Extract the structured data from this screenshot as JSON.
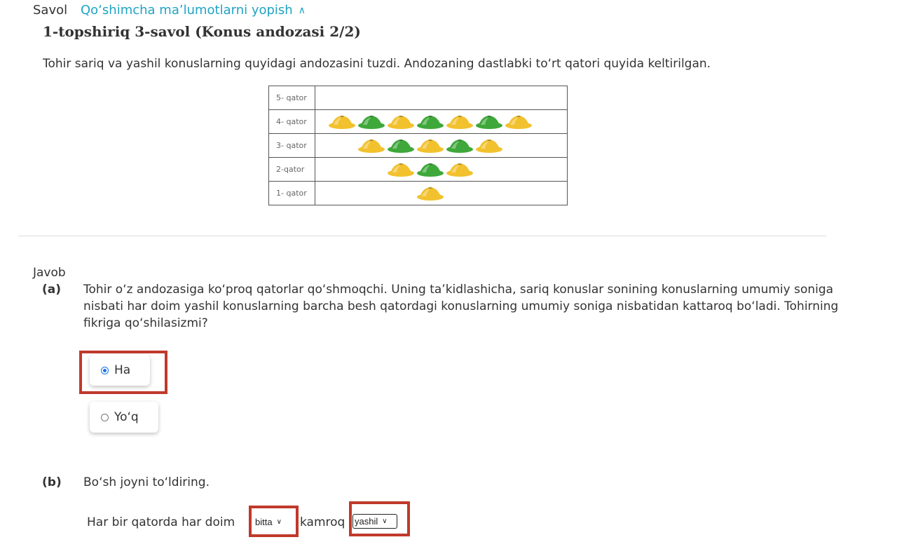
{
  "header": {
    "savol_label": "Savol",
    "toggle_link": "Qo‘shimcha ma’lumotlarni yopish",
    "toggle_icon": "chevron-up-icon"
  },
  "question": {
    "title": "1-topshiriq 3-savol (Konus andozasi 2/2)",
    "intro": "Tohir sariq va yashil konuslarning quyidagi andozasini tuzdi. Andozaning dastlabki to‘rt qatori quyida keltirilgan."
  },
  "pattern_table": {
    "rows": [
      {
        "label": "5- qator",
        "cones": []
      },
      {
        "label": "4- qator",
        "cones": [
          "yellow",
          "green",
          "yellow",
          "green",
          "yellow",
          "green",
          "yellow"
        ]
      },
      {
        "label": "3- qator",
        "cones": [
          "yellow",
          "green",
          "yellow",
          "green",
          "yellow"
        ]
      },
      {
        "label": "2-qator",
        "cones": [
          "yellow",
          "green",
          "yellow"
        ]
      },
      {
        "label": "1-  qator",
        "cones": [
          "yellow"
        ]
      }
    ],
    "colors": {
      "yellow": "#f2c12e",
      "green": "#3ea83a"
    }
  },
  "answer": {
    "label": "Javob",
    "part_a": {
      "label": "(a)",
      "text": "Tohir o‘z andozasiga ko‘proq qatorlar qo‘shmoqchi. Uning ta’kidlashicha, sariq konuslar sonining konuslarning umumiy soniga nisbati har doim yashil konuslarning barcha besh qatordagi konuslarning umumiy soniga nisbatidan kattaroq bo‘ladi. Tohirning fikriga qo‘shilasizmi?",
      "options": [
        {
          "label": "Ha",
          "selected": true
        },
        {
          "label": "Yo‘q",
          "selected": false
        }
      ]
    },
    "part_b": {
      "label": "(b)",
      "text": "Bo‘sh joyni to‘ldiring.",
      "sentence_start": "Har bir qatorda har doim",
      "select1_value": "bitta",
      "sentence_middle": "kamroq",
      "select2_value": "yashil"
    }
  },
  "highlight_color": "#c0392b"
}
